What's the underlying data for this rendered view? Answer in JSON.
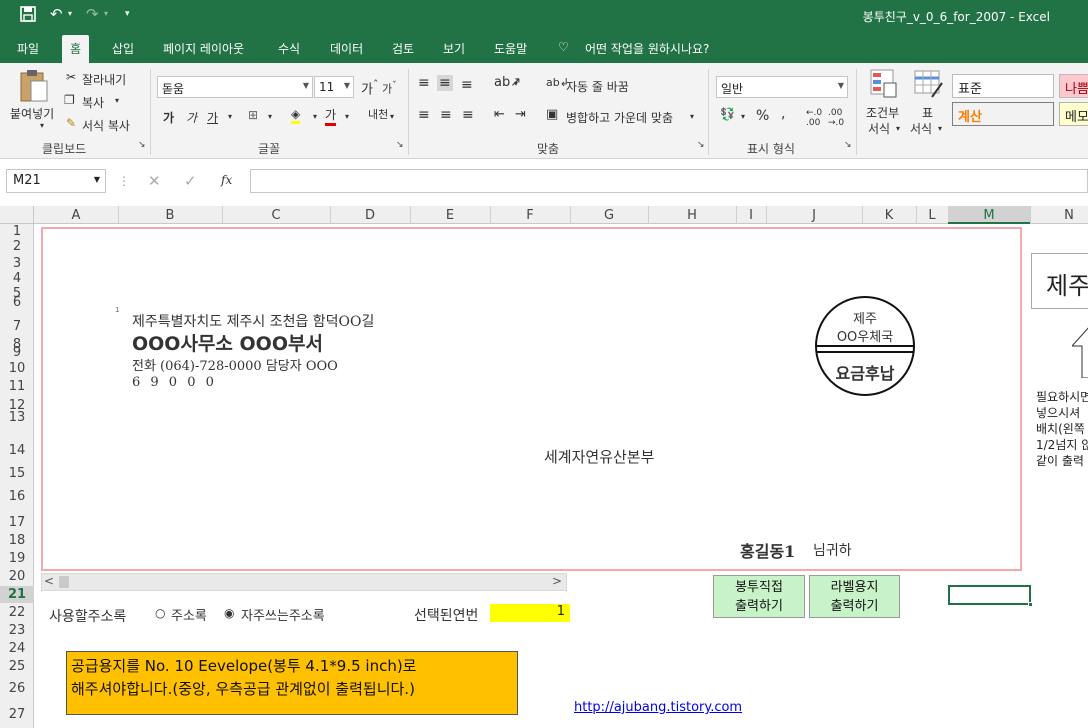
{
  "window": {
    "title": "봉투친구_v_0_6_for_2007  -  Excel"
  },
  "tabs": [
    "파일",
    "홈",
    "삽입",
    "페이지 레이아웃",
    "수식",
    "데이터",
    "검토",
    "보기",
    "도움말"
  ],
  "tellme": "어떤 작업을 원하시나요?",
  "ribbon": {
    "clipboard": {
      "paste": "붙여넣기",
      "cut": "잘라내기",
      "copy": "복사",
      "format_painter": "서식 복사",
      "group": "클립보드"
    },
    "font": {
      "name": "돋움",
      "size": "11",
      "bold": "가",
      "italic": "가",
      "underline": "가",
      "color_a": "가",
      "phonetic": "내천",
      "group": "글꼴"
    },
    "alignment": {
      "wrap": "자동 줄 바꿈",
      "merge": "병합하고 가운데 맞춤",
      "group": "맞춤"
    },
    "number": {
      "format": "일반",
      "group": "표시 형식",
      "percent": "%",
      "comma": ","
    },
    "styles": {
      "conditional": [
        "조건부",
        "서식"
      ],
      "table": [
        "표",
        "서식"
      ],
      "normal": "표준",
      "bad": "나쁨",
      "calc": "계산",
      "memo": "메모"
    }
  },
  "formula_bar": {
    "cell": "M21",
    "fx": "fx",
    "value": ""
  },
  "columns": [
    "A",
    "B",
    "C",
    "D",
    "E",
    "F",
    "G",
    "H",
    "I",
    "J",
    "K",
    "L",
    "M",
    "N"
  ],
  "rows": [
    "1",
    "2",
    "3",
    "4",
    "5",
    "6",
    "7",
    "8",
    "9",
    "10",
    "11",
    "12",
    "13",
    "14",
    "15",
    "16",
    "17",
    "18",
    "19",
    "20",
    "21",
    "22",
    "23",
    "24",
    "25",
    "26",
    "27"
  ],
  "envelope": {
    "addr_line1": "제주특별자치도 제주시 조천읍 함덕OO길",
    "org": "OOO사무소 OOO부서",
    "phone": "전화 (064)-728-0000  담당자 OOO",
    "zip": "6 9 0 0 0",
    "stamp_top": "제주",
    "stamp_mid": "OO우체국",
    "stamp_bottom": "요금후납",
    "recipient_org": "세계자연유산본부",
    "recipient_name": "홍길동1",
    "recipient_suffix": "님귀하",
    "small_mark": "1"
  },
  "controls": {
    "addr_book_label": "사용할주소록",
    "radio_1": "주소록",
    "radio_2": "자주쓰는주소록",
    "radio_selected": 2,
    "selected_no_label": "선택된연번",
    "selected_no_value": "1",
    "btn_print_env": [
      "봉투직접",
      "출력하기"
    ],
    "btn_print_label": [
      "라벨용지",
      "출력하기"
    ]
  },
  "note": {
    "line1": "공급용지를 No. 10 Eevelope(봉투 4.1*9.5 inch)로",
    "line2": "해주셔야합니다.(중앙, 우측공급 관계없이 출력됩니다.)"
  },
  "link": "http://ajubang.tistory.com",
  "side": {
    "title": "제주",
    "lines": [
      "필요하시면",
      "넣으시셔",
      "배치(왼쪽",
      "1/2넘지 않",
      "같이 출력"
    ]
  }
}
